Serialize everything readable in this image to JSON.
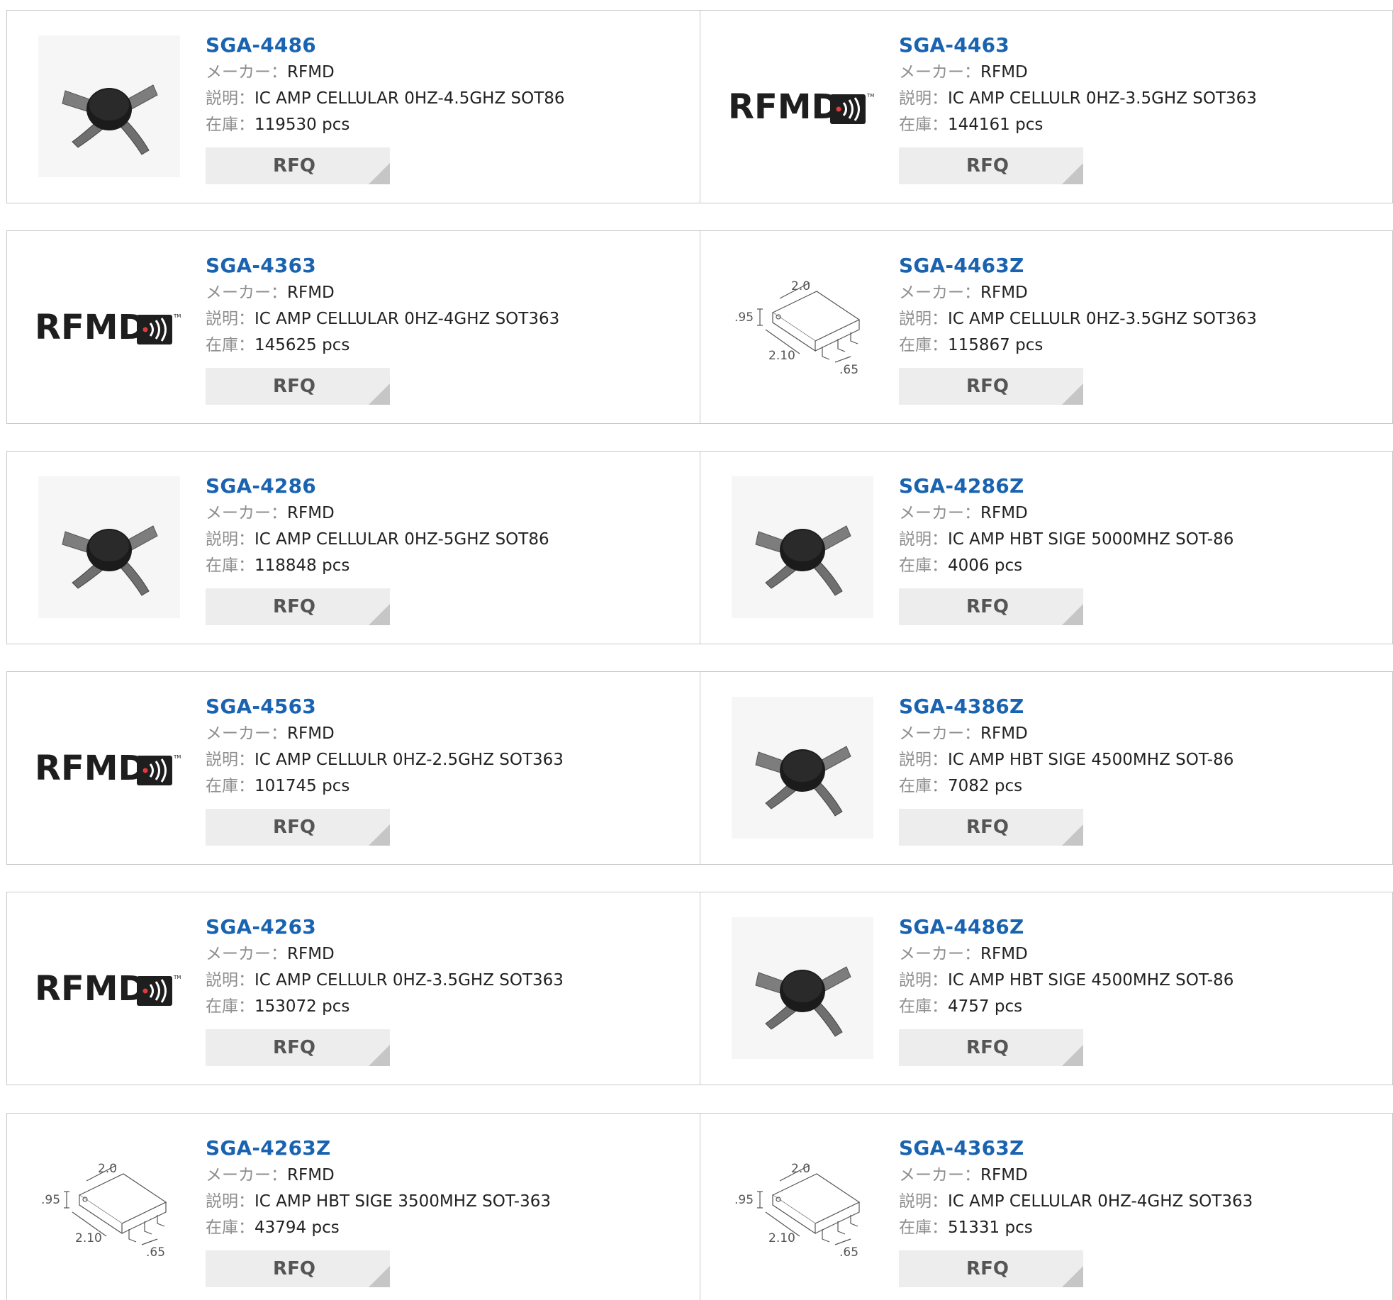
{
  "labels": {
    "maker": "メーカー：",
    "desc": "説明：",
    "stock": "在庫：",
    "rfq": "RFQ"
  },
  "brand_logo_text": "RFMD",
  "rows": [
    [
      {
        "pn": "SGA-4486",
        "maker": "RFMD",
        "desc": "IC AMP CELLULAR 0HZ-4.5GHZ SOT86",
        "stock": "119530 pcs",
        "img": "sot86"
      },
      {
        "pn": "SGA-4463",
        "maker": "RFMD",
        "desc": "IC AMP CELLULR 0HZ-3.5GHZ SOT363",
        "stock": "144161 pcs",
        "img": "rfmd"
      }
    ],
    [
      {
        "pn": "SGA-4363",
        "maker": "RFMD",
        "desc": "IC AMP CELLULAR 0HZ-4GHZ SOT363",
        "stock": "145625 pcs",
        "img": "rfmd"
      },
      {
        "pn": "SGA-4463Z",
        "maker": "RFMD",
        "desc": "IC AMP CELLULR 0HZ-3.5GHZ SOT363",
        "stock": "115867 pcs",
        "img": "sot363"
      }
    ],
    [
      {
        "pn": "SGA-4286",
        "maker": "RFMD",
        "desc": "IC AMP CELLULAR 0HZ-5GHZ SOT86",
        "stock": "118848 pcs",
        "img": "sot86"
      },
      {
        "pn": "SGA-4286Z",
        "maker": "RFMD",
        "desc": "IC AMP HBT SIGE 5000MHZ SOT-86",
        "stock": "4006 pcs",
        "img": "sot86"
      }
    ],
    [
      {
        "pn": "SGA-4563",
        "maker": "RFMD",
        "desc": "IC AMP CELLULR 0HZ-2.5GHZ SOT363",
        "stock": "101745 pcs",
        "img": "rfmd"
      },
      {
        "pn": "SGA-4386Z",
        "maker": "RFMD",
        "desc": "IC AMP HBT SIGE 4500MHZ SOT-86",
        "stock": "7082 pcs",
        "img": "sot86"
      }
    ],
    [
      {
        "pn": "SGA-4263",
        "maker": "RFMD",
        "desc": "IC AMP CELLULR 0HZ-3.5GHZ SOT363",
        "stock": "153072 pcs",
        "img": "rfmd"
      },
      {
        "pn": "SGA-4486Z",
        "maker": "RFMD",
        "desc": "IC AMP HBT SIGE 4500MHZ SOT-86",
        "stock": "4757 pcs",
        "img": "sot86"
      }
    ],
    [
      {
        "pn": "SGA-4263Z",
        "maker": "RFMD",
        "desc": "IC AMP HBT SIGE 3500MHZ SOT-363",
        "stock": "43794 pcs",
        "img": "sot363"
      },
      {
        "pn": "SGA-4363Z",
        "maker": "RFMD",
        "desc": "IC AMP CELLULAR 0HZ-4GHZ SOT363",
        "stock": "51331 pcs",
        "img": "sot363"
      }
    ]
  ],
  "dimension_labels": {
    "width": "2.0",
    "height": ".95",
    "length": "2.10",
    "pitch": ".65"
  }
}
